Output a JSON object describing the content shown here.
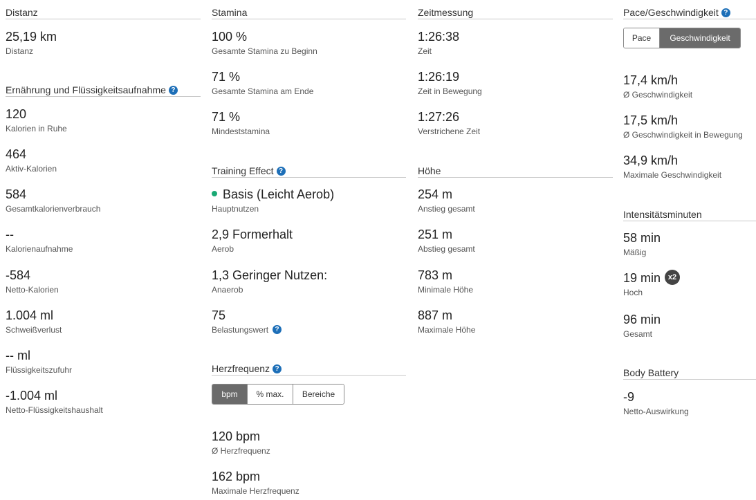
{
  "distance": {
    "header": "Distanz",
    "items": [
      {
        "value": "25,19 km",
        "label": "Distanz"
      }
    ]
  },
  "nutrition": {
    "header": "Ernährung und Flüssigkeitsaufnahme",
    "items": [
      {
        "value": "120",
        "label": "Kalorien in Ruhe"
      },
      {
        "value": "464",
        "label": "Aktiv-Kalorien"
      },
      {
        "value": "584",
        "label": "Gesamtkalorienverbrauch"
      },
      {
        "value": "--",
        "label": "Kalorienaufnahme"
      },
      {
        "value": "-584",
        "label": "Netto-Kalorien"
      },
      {
        "value": "1.004 ml",
        "label": "Schweißverlust"
      },
      {
        "value": "-- ml",
        "label": "Flüssigkeitszufuhr"
      },
      {
        "value": "-1.004 ml",
        "label": "Netto-Flüssigkeitshaushalt"
      }
    ]
  },
  "stamina": {
    "header": "Stamina",
    "items": [
      {
        "value": "100 %",
        "label": "Gesamte Stamina zu Beginn"
      },
      {
        "value": "71 %",
        "label": "Gesamte Stamina am Ende"
      },
      {
        "value": "71 %",
        "label": "Mindeststamina"
      }
    ]
  },
  "training_effect": {
    "header": "Training Effect",
    "items": [
      {
        "value": "Basis (Leicht Aerob)",
        "label": "Hauptnutzen",
        "dot_color": "#19a974"
      },
      {
        "value": "2,9 Formerhalt",
        "label": "Aerob"
      },
      {
        "value": "1,3 Geringer Nutzen:",
        "label": "Anaerob"
      },
      {
        "value": "75",
        "label": "Belastungswert"
      }
    ]
  },
  "heart_rate": {
    "header": "Herzfrequenz",
    "toggle": [
      "bpm",
      "% max.",
      "Bereiche"
    ],
    "items": [
      {
        "value": "120 bpm",
        "label": "Ø Herzfrequenz"
      },
      {
        "value": "162 bpm",
        "label": "Maximale Herzfrequenz"
      }
    ]
  },
  "timing": {
    "header": "Zeitmessung",
    "items": [
      {
        "value": "1:26:38",
        "label": "Zeit"
      },
      {
        "value": "1:26:19",
        "label": "Zeit in Bewegung"
      },
      {
        "value": "1:27:26",
        "label": "Verstrichene Zeit"
      }
    ]
  },
  "elevation": {
    "header": "Höhe",
    "items": [
      {
        "value": "254 m",
        "label": "Anstieg gesamt"
      },
      {
        "value": "251 m",
        "label": "Abstieg gesamt"
      },
      {
        "value": "783 m",
        "label": "Minimale Höhe"
      },
      {
        "value": "887 m",
        "label": "Maximale Höhe"
      }
    ]
  },
  "pace": {
    "header": "Pace/Geschwindigkeit",
    "toggle": [
      "Pace",
      "Geschwindigkeit"
    ],
    "items": [
      {
        "value": "17,4 km/h",
        "label": "Ø Geschwindigkeit"
      },
      {
        "value": "17,5 km/h",
        "label": "Ø Geschwindigkeit in Bewegung"
      },
      {
        "value": "34,9 km/h",
        "label": "Maximale Geschwindigkeit"
      }
    ]
  },
  "intensity": {
    "header": "Intensitätsminuten",
    "items": [
      {
        "value": "58 min",
        "label": "Mäßig"
      },
      {
        "value": "19 min",
        "label": "Hoch",
        "badge": "x2"
      },
      {
        "value": "96 min",
        "label": "Gesamt"
      }
    ]
  },
  "body_battery": {
    "header": "Body Battery",
    "items": [
      {
        "value": "-9",
        "label": "Netto-Auswirkung"
      }
    ]
  },
  "help_glyph": "?",
  "accent_color": "#1d6fb8"
}
